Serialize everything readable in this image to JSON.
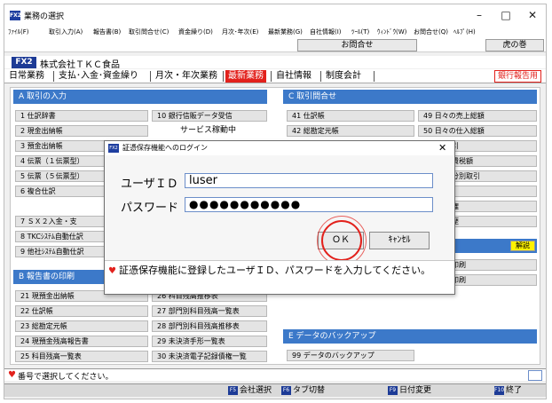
{
  "window": {
    "title": "業務の選択",
    "app_icon": "FX2",
    "controls": [
      "–",
      "□",
      "✕"
    ]
  },
  "menu": [
    "ﾌｧｲﾙ(F)",
    "取引入力(A)",
    "報告書(B)",
    "取引問合せ(C)",
    "資金繰り(D)",
    "月次･年次(E)",
    "最新業務(G)",
    "自社情報(I)",
    "ﾂｰﾙ(T)",
    "ｳｨﾝﾄﾞｳ(W)",
    "お問合せ(Q)",
    "ﾍﾙﾌﾟ(H)"
  ],
  "toolbar": {
    "inquiry": "お問合せ",
    "tora": "虎の巻"
  },
  "company": {
    "badge": "FX2",
    "name": "株式会社ＴＫＣ食品"
  },
  "tabs": [
    "日常業務",
    "支払･入金･資金繰り",
    "月次・年次業務",
    "最新業務",
    "自社情報",
    "制度会計"
  ],
  "bank_report": "銀行報告用",
  "section_a": {
    "title": "A 取引の入力",
    "left_items": [
      "1 仕訳辞書",
      "2 現金出納帳",
      "3 預金出納帳",
      "4 伝票（１伝票型）",
      "5 伝票（５伝票型）",
      "6 複合仕訳",
      "7 ＳＸ２入金・支",
      "8 TKCｼｽﾃﾑ自動仕訳",
      "9 他社ｼｽﾃﾑ自動仕訳"
    ],
    "right_item": "10 銀行信販データ受信",
    "service_text": "サービス稼動中"
  },
  "section_b": {
    "title": "B 報告書の印刷",
    "left_items": [
      "21 現預金出納帳",
      "22 仕訳帳",
      "23 総勘定元帳",
      "24 現預金残高報告書",
      "25 科目残高一覧表"
    ],
    "right_items": [
      "26 科目残高推移表",
      "27 部門別科目残高一覧表",
      "28 部門別科目残高推移表",
      "29 未決済手形一覧表",
      "30 未決済電子記録債権一覧"
    ]
  },
  "section_c": {
    "title": "C 取引問合せ",
    "left_items": [
      "41 仕訳帳",
      "42 総勘定元帳"
    ],
    "right_items": [
      "49 日々の売上総額",
      "50 日々の仕入総額",
      "区分別取引",
      "科目別消費税額",
      "別課税区分別取引",
      "明細",
      "子記録債権",
      "・加除履歴"
    ],
    "help": "解説",
    "lower_items": [
      "一覧表の印刷",
      "明細書の印刷"
    ]
  },
  "section_e": {
    "title": "E データのバックアップ",
    "item": "99 データのバックアップ"
  },
  "status": {
    "message": "番号で選択してください。"
  },
  "fkeys": [
    {
      "key": "F5",
      "label": "会社選択"
    },
    {
      "key": "F6",
      "label": "タブ切替"
    },
    {
      "key": "F9",
      "label": "日付変更"
    },
    {
      "key": "F10",
      "label": "終了"
    }
  ],
  "dialog": {
    "icon": "FX2",
    "title": "証憑保存機能へのログイン",
    "close": "✕",
    "user_label": "ユーザＩＤ",
    "user_value": "luser",
    "password_label": "パスワード",
    "password_value": "●●●●●●●●●●●",
    "ok_label": "ＯＫ",
    "cancel_label": "ｷｬﾝｾﾙ",
    "hint": "証憑保存機能に登録したユーザＩＤ、パスワードを入力してください。"
  },
  "colors": {
    "section_blue": "#3c79c9",
    "badge_navy": "#1d3b96",
    "red": "#e2211c",
    "highlight_yellow": "#fff200"
  }
}
